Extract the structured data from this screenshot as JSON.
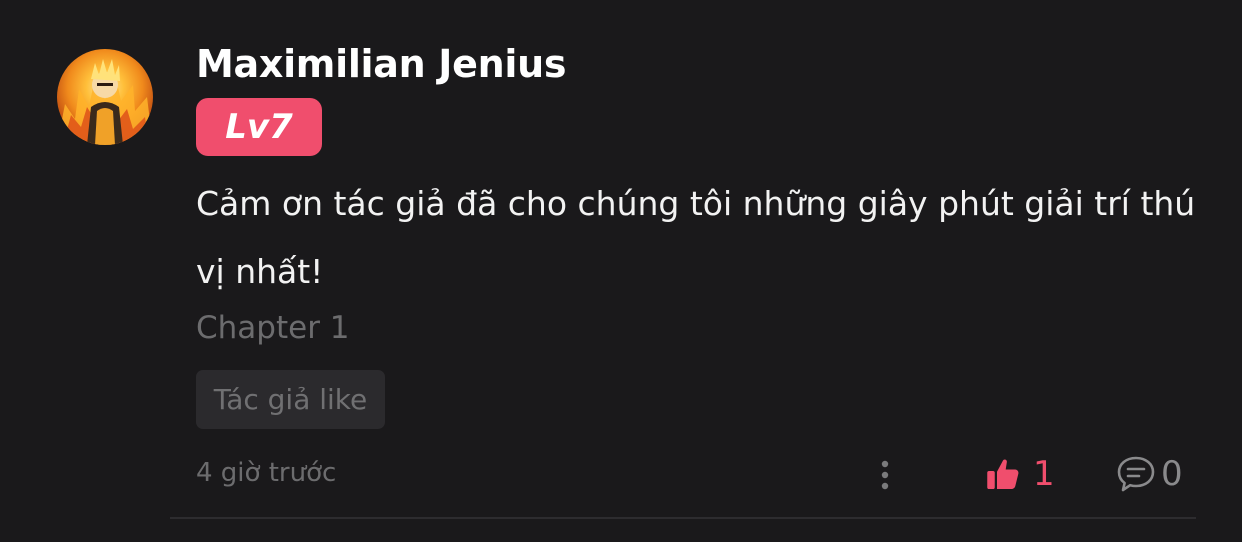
{
  "comment": {
    "username": "Maximilian Jenius",
    "level": "Lv7",
    "text": "Cảm ơn tác giả đã cho chúng tôi những giây phút giải trí thú vị nhất!",
    "chapter": "Chapter 1",
    "author_like_label": "Tác giả like",
    "timestamp": "4 giờ trước",
    "like_count": "1",
    "reply_count": "0"
  },
  "colors": {
    "background": "#1a191b",
    "accent": "#f04e6d",
    "muted_text": "#6c6c6e",
    "primary_text": "#ffffff"
  },
  "icons": {
    "more": "vertical-dots-icon",
    "like": "thumbs-up-icon",
    "reply": "chat-bubble-icon"
  }
}
